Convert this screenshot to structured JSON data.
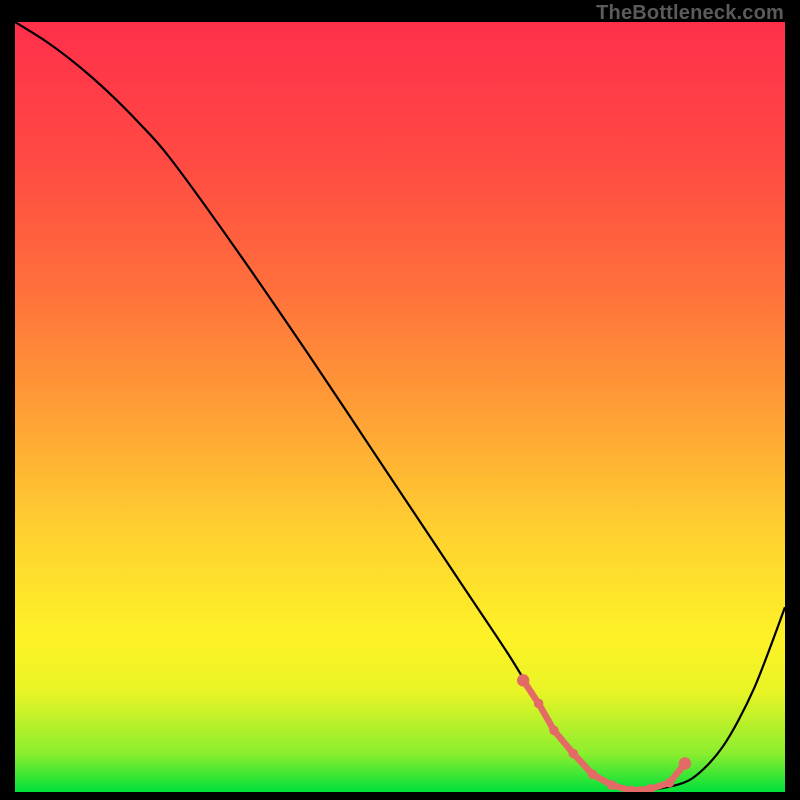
{
  "watermark": "TheBottleneck.com",
  "chart_data": {
    "type": "line",
    "title": "",
    "xlabel": "",
    "ylabel": "",
    "xlim": [
      0,
      100
    ],
    "ylim": [
      0,
      100
    ],
    "grid": false,
    "legend": false,
    "background_gradient": {
      "stops": [
        {
          "pos": 0.0,
          "color": "#00e03a"
        },
        {
          "pos": 0.05,
          "color": "#8bee2e"
        },
        {
          "pos": 0.13,
          "color": "#e8f426"
        },
        {
          "pos": 0.2,
          "color": "#fef227"
        },
        {
          "pos": 0.34,
          "color": "#ffd030"
        },
        {
          "pos": 0.5,
          "color": "#ff9d36"
        },
        {
          "pos": 0.66,
          "color": "#ff6e3c"
        },
        {
          "pos": 0.82,
          "color": "#ff4a43"
        },
        {
          "pos": 1.0,
          "color": "#ff2f4b"
        }
      ]
    },
    "series": [
      {
        "name": "bottleneck-curve",
        "x": [
          0,
          4,
          8,
          12,
          16,
          20,
          28,
          38,
          48,
          58,
          64,
          68,
          72,
          76,
          80,
          84,
          88,
          92,
          96,
          100
        ],
        "y": [
          100.0,
          97.5,
          94.5,
          91.0,
          87.0,
          82.5,
          71.5,
          57.0,
          42.0,
          27.0,
          18.0,
          11.5,
          5.5,
          1.5,
          0.2,
          0.5,
          1.8,
          6.0,
          13.5,
          24.0
        ]
      }
    ],
    "valley_markers": {
      "name": "valley-dots",
      "color": "#e46a66",
      "x": [
        66.0,
        68.0,
        70.0,
        72.5,
        75.0,
        77.5,
        80.0,
        82.5,
        85.0,
        87.0
      ],
      "y": [
        14.5,
        11.5,
        8.0,
        5.0,
        2.3,
        0.9,
        0.2,
        0.4,
        1.2,
        3.7
      ]
    }
  }
}
